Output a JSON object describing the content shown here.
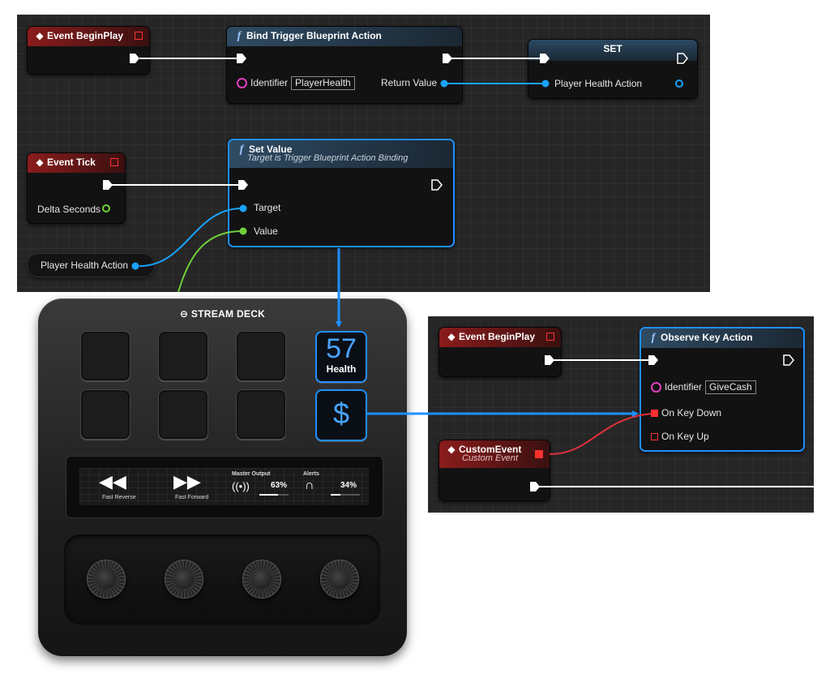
{
  "top_graph": {
    "event_beginplay": {
      "title": "Event BeginPlay"
    },
    "bind_trigger": {
      "title": "Bind Trigger Blueprint Action",
      "identifier_label": "Identifier",
      "identifier_value": "PlayerHealth",
      "return_label": "Return Value"
    },
    "set_node": {
      "title": "SET",
      "pin_label": "Player Health Action"
    },
    "event_tick": {
      "title": "Event Tick",
      "delta_label": "Delta Seconds"
    },
    "set_value": {
      "title": "Set Value",
      "subtitle": "Target is Trigger Blueprint Action Binding",
      "target_label": "Target",
      "value_label": "Value"
    },
    "var_node": {
      "label": "Player Health Action"
    }
  },
  "right_graph": {
    "event_beginplay": {
      "title": "Event BeginPlay"
    },
    "observe_key": {
      "title": "Observe Key Action",
      "identifier_label": "Identifier",
      "identifier_value": "GiveCash",
      "key_down_label": "On Key Down",
      "key_up_label": "On Key Up"
    },
    "custom_event": {
      "title": "CustomEvent",
      "subtitle": "Custom Event"
    }
  },
  "stream_deck": {
    "logo": "STREAM DECK",
    "health_key": {
      "value": "57",
      "label": "Health"
    },
    "cash_key": {
      "symbol": "$"
    },
    "screen": {
      "fast_reverse": "Fast Reverse",
      "fast_forward": "Fast Forward",
      "master_output": {
        "label": "Master Output",
        "percent": "63%",
        "level": 0.63
      },
      "alerts": {
        "label": "Alerts",
        "percent": "34%",
        "level": 0.34
      }
    }
  },
  "colors": {
    "exec": "#ffffff",
    "object_pin": "#1aa3ff",
    "float_pin": "#6fd13a",
    "event_pin": "#e0303a",
    "selection": "#1e8fff"
  }
}
